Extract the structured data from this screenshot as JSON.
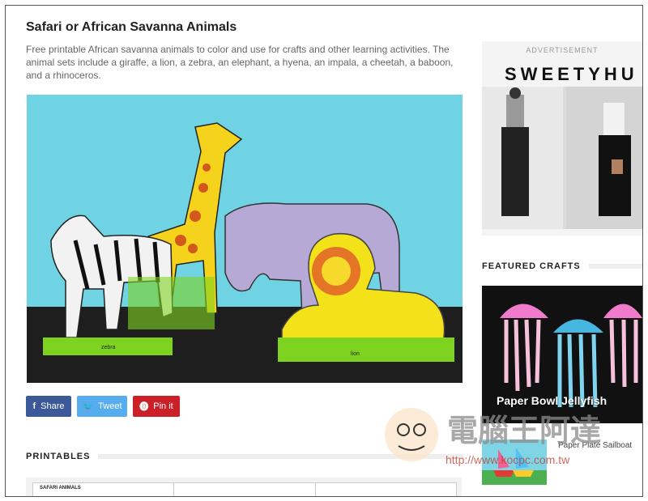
{
  "article": {
    "title": "Safari or African Savanna Animals",
    "description": "Free printable African savanna animals to color and use for crafts and other learning activities. The animal sets include a giraffe, a lion, a zebra, an elephant, a hyena, an impala, a cheetah, a baboon, and a rhinoceros.",
    "hero_labels": {
      "zebra": "zebra",
      "lion": "lion"
    }
  },
  "share": {
    "facebook": {
      "icon": "facebook-icon",
      "label": "Share",
      "color": "#3b5998"
    },
    "twitter": {
      "icon": "twitter-icon",
      "label": "Tweet",
      "color": "#55acee"
    },
    "pinterest": {
      "icon": "pinterest-icon",
      "label": "Pin it",
      "color": "#cb2027"
    }
  },
  "printables": {
    "heading": "PRINTABLES",
    "cells": [
      "SAFARI ANIMALS",
      "",
      ""
    ]
  },
  "sidebar": {
    "ad": {
      "label": "ADVERTISEMENT",
      "brand": "SWEETYHU"
    },
    "featured": {
      "heading": "FEATURED CRAFTS",
      "main_title": "Paper Bowl Jellyfish",
      "secondary_title": "Paper Plate Sailboat"
    }
  },
  "watermark": {
    "text": "電腦王阿達",
    "url": "http://www.kocpc.com.tw"
  }
}
